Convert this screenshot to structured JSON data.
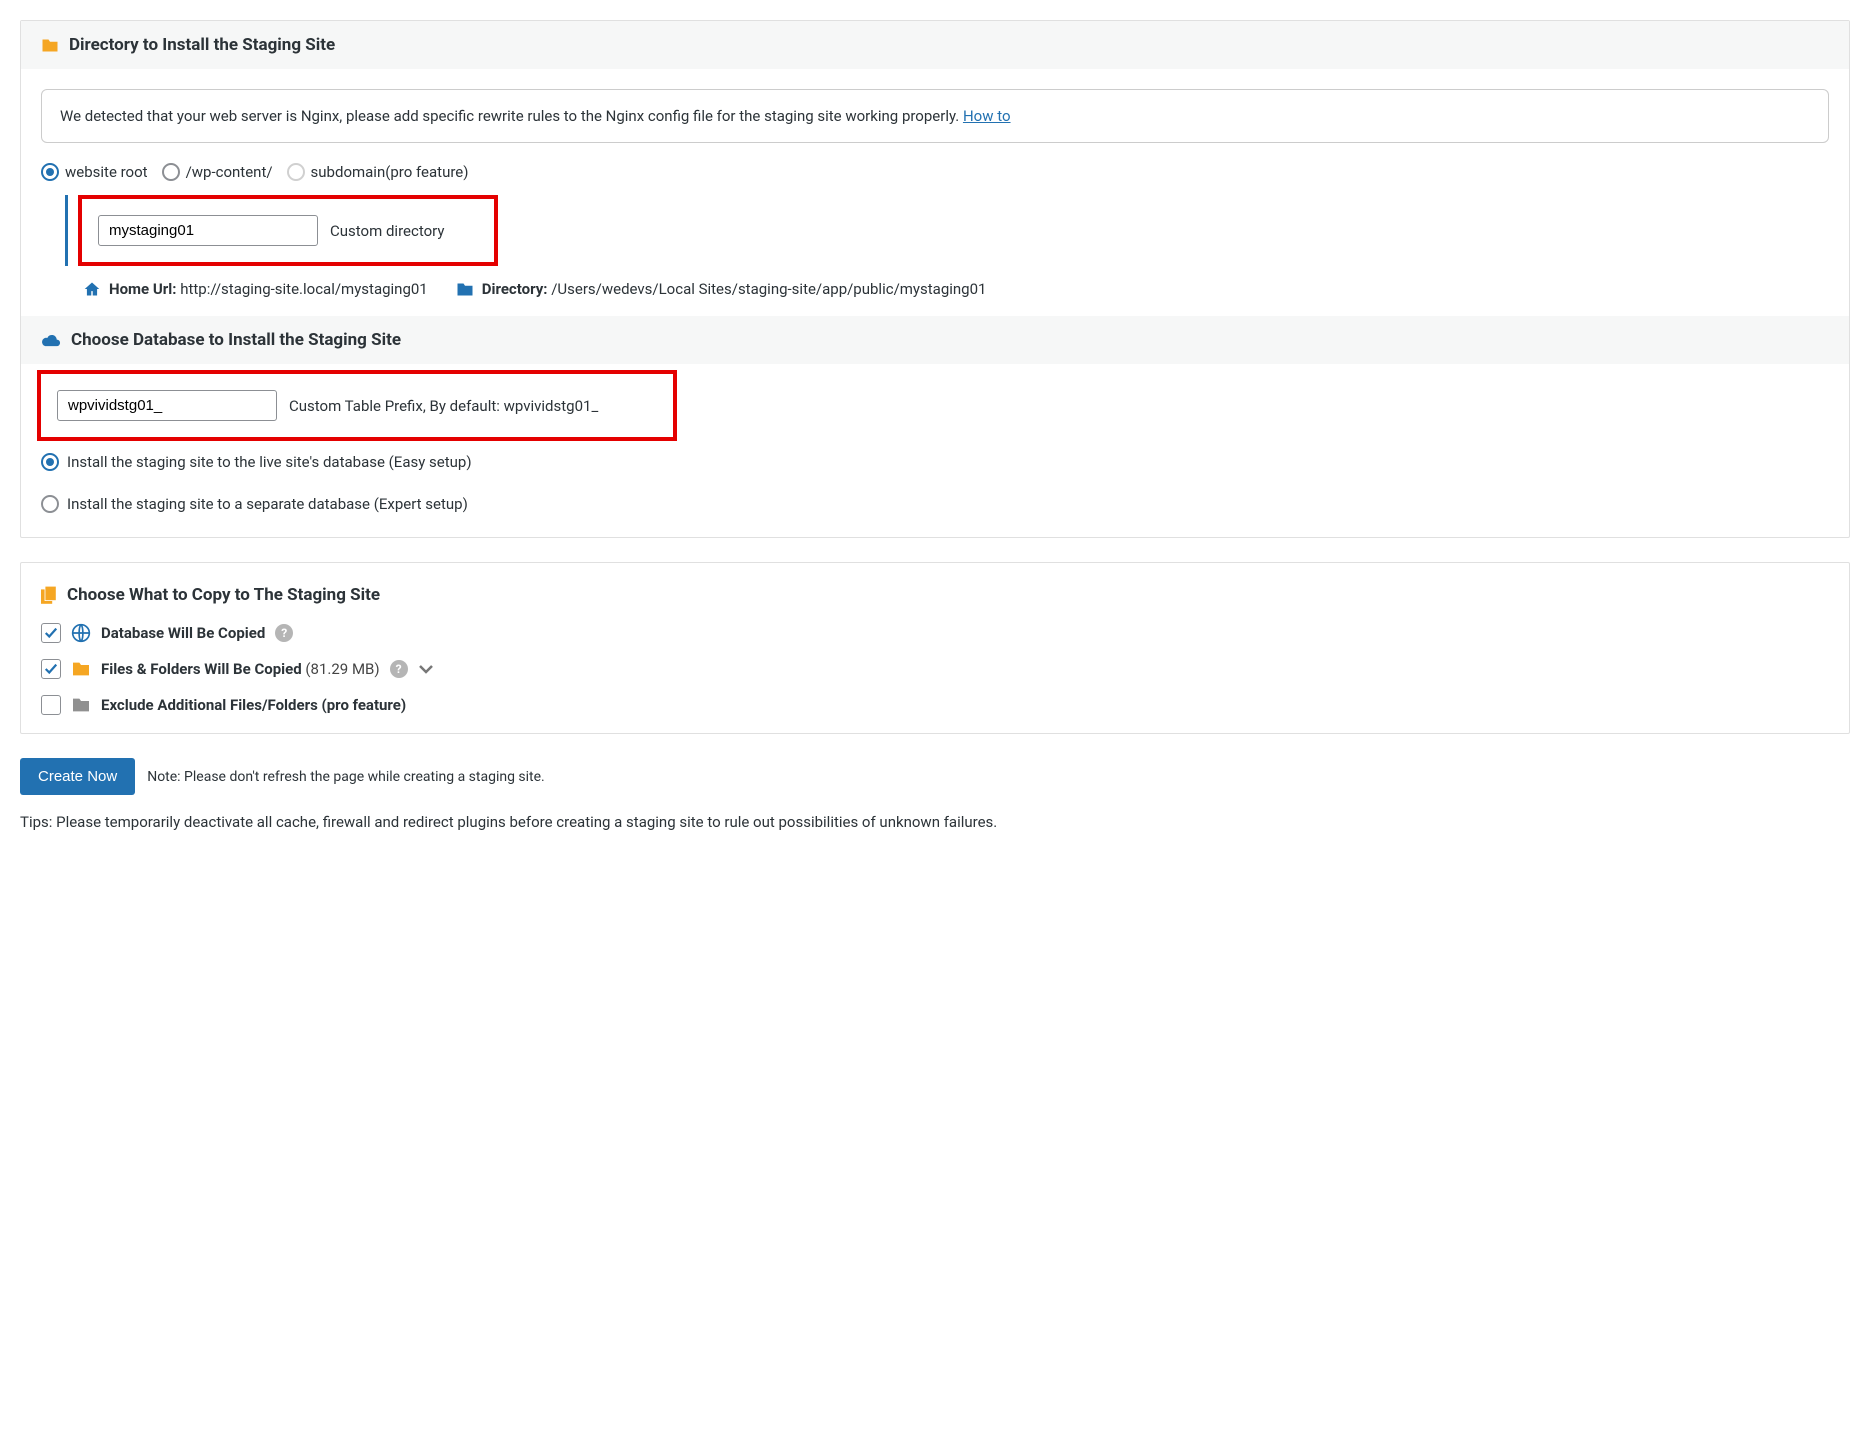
{
  "dir_section": {
    "title": "Directory to Install the Staging Site",
    "notice_text": "We detected that your web server is Nginx, please add specific rewrite rules to the Nginx config file for the staging site working properly. ",
    "howto_link": "How to",
    "radios": {
      "website_root": "website root",
      "wp_content": "/wp-content/",
      "subdomain": "subdomain(pro feature)"
    },
    "custom_dir_value": "mystaging01",
    "custom_dir_label": "Custom directory",
    "home_url_label": "Home Url:",
    "home_url": " http://staging-site.local/mystaging01",
    "directory_label": "Directory:",
    "directory_path": " /Users/wedevs/Local Sites/staging-site/app/public/mystaging01"
  },
  "db_section": {
    "title": "Choose Database to Install the Staging Site",
    "prefix_value": "wpvividstg01_",
    "prefix_label": "Custom Table Prefix, By default: wpvividstg01_",
    "radio_easy": "Install the staging site to the live site's database (Easy setup)",
    "radio_expert": "Install the staging site to a separate database (Expert setup)"
  },
  "copy_section": {
    "title": "Choose What to Copy to The Staging Site",
    "item_db": "Database Will Be Copied",
    "item_files": "Files & Folders Will Be Copied",
    "item_files_size": " (81.29 MB)",
    "item_exclude": "Exclude Additional Files/Folders (pro feature)"
  },
  "footer": {
    "create_btn": "Create Now",
    "create_note": "Note: Please don't refresh the page while creating a staging site.",
    "tips": "Tips: Please temporarily deactivate all cache, firewall and redirect plugins before creating a staging site to rule out possibilities of unknown failures."
  }
}
